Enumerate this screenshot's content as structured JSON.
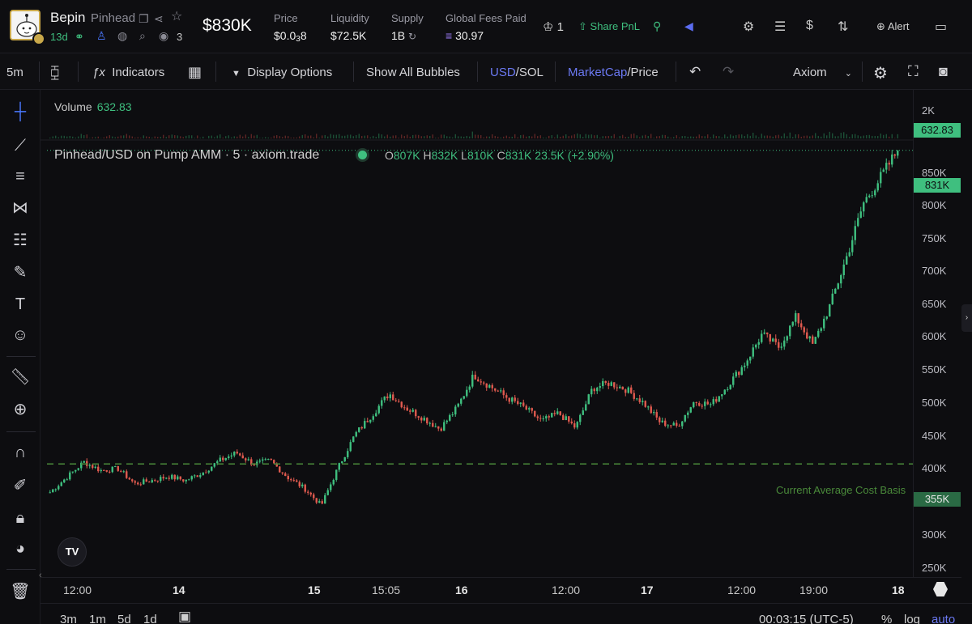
{
  "header": {
    "token_name": "Bepin",
    "ticker": "Pinhead",
    "age": "13d",
    "viewers": "3",
    "market_cap": "$830K",
    "stats": [
      {
        "label": "Price",
        "value": "$0.0",
        "sub": "3",
        "tail": "8"
      },
      {
        "label": "Liquidity",
        "value": "$72.5K"
      },
      {
        "label": "Supply",
        "value": "1B"
      },
      {
        "label": "Global Fees Paid",
        "value": "30.97"
      }
    ],
    "crown_count": "1",
    "share_label": "Share PnL",
    "alert_label": "Alert"
  },
  "toolbar": {
    "interval": "5m",
    "indicators_label": "Indicators",
    "display_options_label": "Display Options",
    "bubbles_label": "Show All Bubbles",
    "currency_active": "USD",
    "currency_inactive": "/SOL",
    "metric_active": "MarketCap",
    "metric_inactive": "/Price",
    "provider": "Axiom"
  },
  "legend": {
    "volume_label": "Volume",
    "volume_value": "632.83",
    "pair": "Pinhead/USD on Pump AMM · 5 · axiom.trade",
    "open": "807K",
    "high": "832K",
    "low": "810K",
    "close": "831K",
    "change": "23.5K (+2.90%)",
    "cost_basis_label": "Current Average Cost Basis",
    "tv_logo": "TV"
  },
  "price_axis": {
    "ticks": [
      "2K",
      "850K",
      "800K",
      "750K",
      "700K",
      "650K",
      "600K",
      "550K",
      "500K",
      "450K",
      "400K",
      "300K",
      "250K"
    ],
    "volume_badge": "632.83",
    "last_price_badge": "831K",
    "cost_basis_badge": "355K"
  },
  "time_axis": {
    "ticks": [
      "12:00",
      "14",
      "15",
      "15:05",
      "16",
      "12:00",
      "17",
      "12:00",
      "19:00",
      "18"
    ]
  },
  "bottom": {
    "ranges": [
      "3m",
      "1m",
      "5d",
      "1d"
    ],
    "clock": "00:03:15 (UTC-5)",
    "percent": "%",
    "log": "log",
    "auto": "auto"
  },
  "colors": {
    "up": "#3fbf7f",
    "down": "#e05a4f",
    "accent": "#6b79f2",
    "cost_basis": "#4a8a3a"
  },
  "chart_data": {
    "type": "candlestick",
    "title": "Pinhead/USD on Pump AMM · 5 · axiom.trade",
    "ylabel": "MarketCap (USD)",
    "ylim": [
      230000,
      870000
    ],
    "x_ticks": [
      "12:00",
      "14",
      "15",
      "15:05",
      "16",
      "12:00",
      "17",
      "12:00",
      "19:00",
      "18"
    ],
    "cost_basis": 355000,
    "last": 831000,
    "path": [
      312000,
      335000,
      358000,
      345000,
      348000,
      325000,
      330000,
      336000,
      330000,
      342000,
      360000,
      372000,
      355000,
      360000,
      335000,
      318000,
      292000,
      350000,
      400000,
      430000,
      462000,
      440000,
      425000,
      408000,
      440000,
      490000,
      472000,
      455000,
      440000,
      420000,
      432000,
      410000,
      470000,
      478000,
      468000,
      448000,
      418000,
      412000,
      450000,
      445000,
      475000,
      508000,
      552000,
      532000,
      578000,
      535000,
      595000,
      670000,
      752000,
      790000,
      831000
    ]
  }
}
